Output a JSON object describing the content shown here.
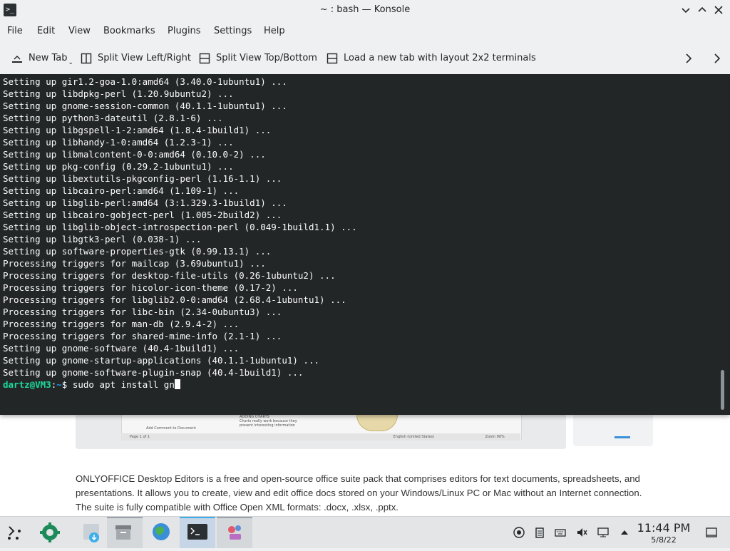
{
  "window": {
    "title": "~ : bash — Konsole",
    "app_icon": ">_"
  },
  "menubar": {
    "items": [
      "File",
      "Edit",
      "View",
      "Bookmarks",
      "Plugins",
      "Settings",
      "Help"
    ]
  },
  "toolbar": {
    "new_tab": "New Tab",
    "split_lr": "Split View Left/Right",
    "split_tb": "Split View Top/Bottom",
    "layout_2x2": "Load a new tab with layout 2x2 terminals"
  },
  "terminal": {
    "lines": [
      "Setting up gir1.2-goa-1.0:amd64 (3.40.0-1ubuntu1) ...",
      "Setting up libdpkg-perl (1.20.9ubuntu2) ...",
      "Setting up gnome-session-common (40.1.1-1ubuntu1) ...",
      "Setting up python3-dateutil (2.8.1-6) ...",
      "Setting up libgspell-1-2:amd64 (1.8.4-1build1) ...",
      "Setting up libhandy-1-0:amd64 (1.2.3-1) ...",
      "Setting up libmalcontent-0-0:amd64 (0.10.0-2) ...",
      "Setting up pkg-config (0.29.2-1ubuntu1) ...",
      "Setting up libextutils-pkgconfig-perl (1.16-1.1) ...",
      "Setting up libcairo-perl:amd64 (1.109-1) ...",
      "Setting up libglib-perl:amd64 (3:1.329.3-1build1) ...",
      "Setting up libcairo-gobject-perl (1.005-2build2) ...",
      "Setting up libglib-object-introspection-perl (0.049-1build1.1) ...",
      "Setting up libgtk3-perl (0.038-1) ...",
      "Setting up software-properties-gtk (0.99.13.1) ...",
      "Processing triggers for mailcap (3.69ubuntu1) ...",
      "Processing triggers for desktop-file-utils (0.26-1ubuntu2) ...",
      "Processing triggers for hicolor-icon-theme (0.17-2) ...",
      "Processing triggers for libglib2.0-0:amd64 (2.68.4-1ubuntu1) ...",
      "Processing triggers for libc-bin (2.34-0ubuntu3) ...",
      "Processing triggers for man-db (2.9.4-2) ...",
      "Processing triggers for shared-mime-info (2.1-1) ...",
      "Setting up gnome-software (40.4-1build1) ...",
      "Setting up gnome-startup-applications (40.1.1-1ubuntu1) ...",
      "Setting up gnome-software-plugin-snap (40.4-1build1) ..."
    ],
    "prompt_user": "dartz@VM3",
    "prompt_sep": ":",
    "prompt_path": "~",
    "prompt_symbol": "$ ",
    "command": "sudo apt install gn"
  },
  "background_page": {
    "paragraph": "ONLYOFFICE Desktop Editors is a free and open-source office suite pack that comprises editors for text documents, spreadsheets, and presentations. It allows you to create, view and edit office docs stored on your Windows/Linux PC or Mac without an Internet connection. The suite is fully compatible with Office Open XML formats: .docx, .xlsx, .pptx.",
    "shot_heading": "ADDING CHARTS",
    "shot_caption": "Charts really work because they present interesting information",
    "shot_page": "Page 1 of 1",
    "shot_add_comment": "Add Comment to Document",
    "shot_lang": "English (United States)",
    "shot_zoom": "Zoom 90%"
  },
  "taskbar": {
    "time": "11:44 PM",
    "date": "5/8/22"
  },
  "colors": {
    "terminal_bg": "#232627",
    "terminal_fg": "#fcfcfc",
    "prompt_user": "#1cdc9a",
    "prompt_path": "#1d99f3",
    "accent": "#3daee9"
  }
}
